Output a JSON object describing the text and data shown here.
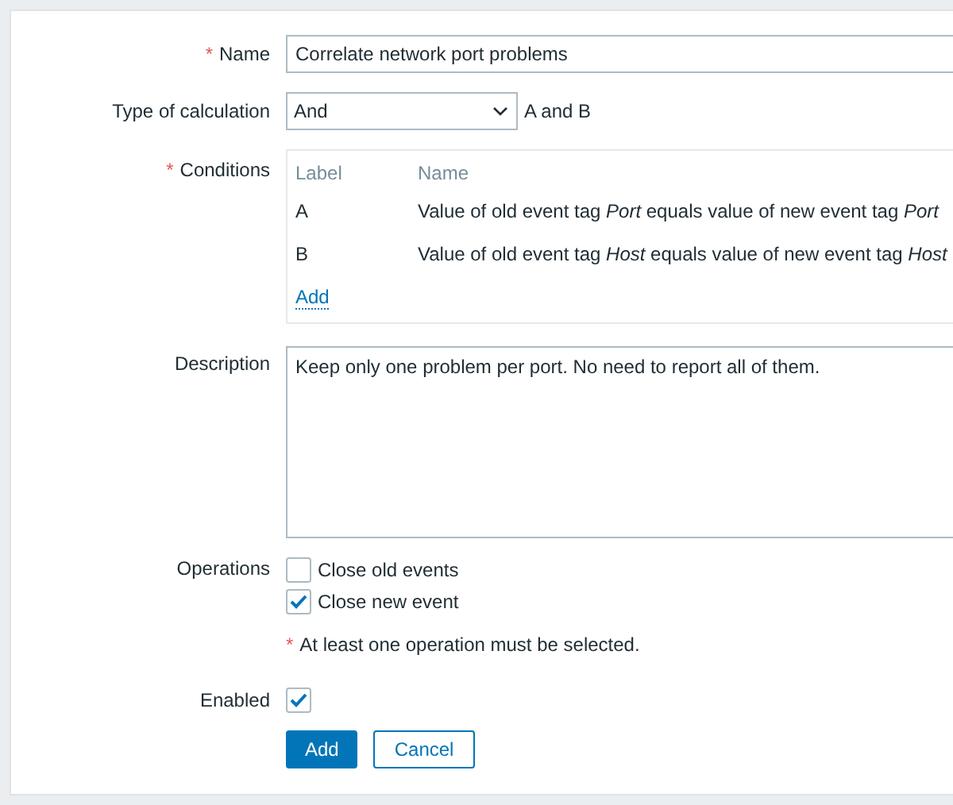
{
  "form": {
    "name": {
      "label": "Name",
      "required_mark": "*",
      "value": "Correlate network port problems"
    },
    "calculation": {
      "label": "Type of calculation",
      "value": "And",
      "formula": "A and B"
    },
    "conditions": {
      "label": "Conditions",
      "required_mark": "*",
      "columns": [
        "Label",
        "Name"
      ],
      "rows": [
        {
          "label": "A",
          "name": "Value of old event tag *Port* equals value of new event tag *Port*"
        },
        {
          "label": "B",
          "name": "Value of old event tag *Host* equals value of new event tag *Host*"
        }
      ],
      "add_link": "Add"
    },
    "description": {
      "label": "Description",
      "value": "Keep only one problem per port. No need to report all of them."
    },
    "operations": {
      "label": "Operations",
      "options": [
        {
          "label": "Close old events",
          "checked": false
        },
        {
          "label": "Close new event",
          "checked": true
        }
      ],
      "hint_mark": "*",
      "hint": "At least one operation must be selected."
    },
    "enabled": {
      "label": "Enabled",
      "checked": true
    },
    "buttons": [
      {
        "label": "Add",
        "kind": "primary"
      },
      {
        "label": "Cancel",
        "kind": "secondary"
      }
    ]
  }
}
